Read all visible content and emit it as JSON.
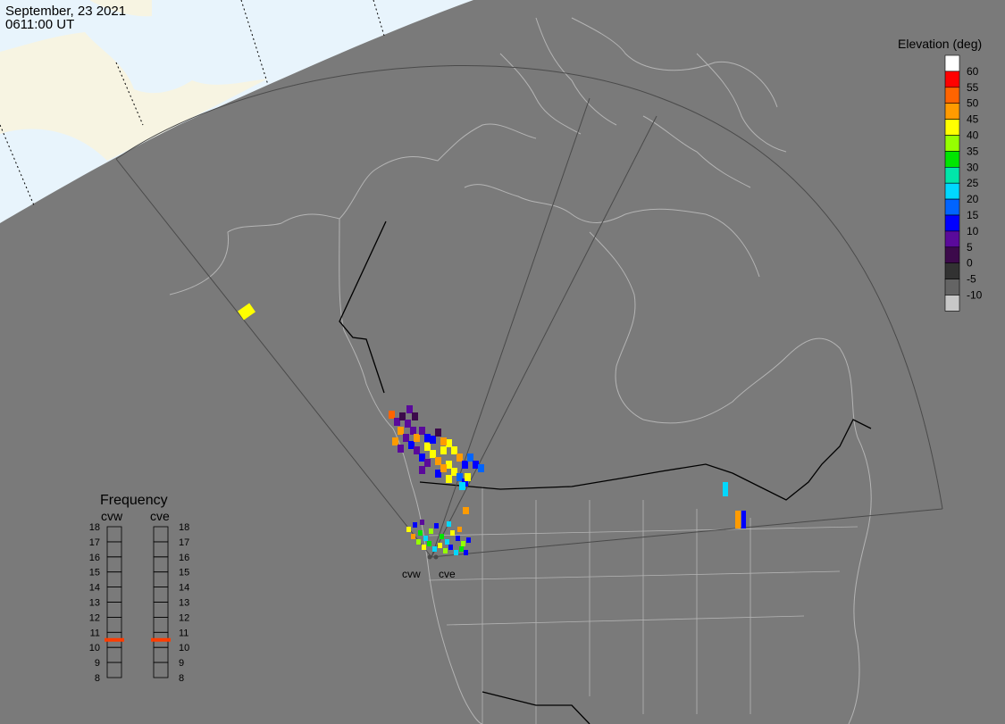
{
  "header": {
    "date": "September, 23 2021",
    "time": "0611:00 UT"
  },
  "colors": {
    "background": "#7a7a7a",
    "daylight_ocean": "#e8f4fc",
    "daylight_land": "#f7f4e2",
    "coastline": "#b4b4b4",
    "borders": "#000000",
    "fov": "#4a4a4a"
  },
  "elevation_scale": {
    "title": "Elevation (deg)",
    "levels": [
      {
        "label": "60",
        "color": "#ffffff"
      },
      {
        "label": "55",
        "color": "#ff0000"
      },
      {
        "label": "50",
        "color": "#ff6400"
      },
      {
        "label": "45",
        "color": "#ff9b00"
      },
      {
        "label": "40",
        "color": "#ffff00"
      },
      {
        "label": "35",
        "color": "#96ff00"
      },
      {
        "label": "30",
        "color": "#00e600"
      },
      {
        "label": "25",
        "color": "#00e6aa"
      },
      {
        "label": "20",
        "color": "#00d8ff"
      },
      {
        "label": "15",
        "color": "#0064ff"
      },
      {
        "label": "10",
        "color": "#0000ff"
      },
      {
        "label": "5",
        "color": "#5a0a9b"
      },
      {
        "label": "0",
        "color": "#3c0a4b"
      },
      {
        "label": "-5",
        "color": "#323232"
      },
      {
        "label": "-10",
        "color": "#646464"
      },
      {
        "label": "",
        "color": "#c8c8c8"
      }
    ]
  },
  "radars": [
    {
      "id": "cvw",
      "label": "cvw"
    },
    {
      "id": "cve",
      "label": "cve"
    }
  ],
  "frequency_panel": {
    "title": "Frequency",
    "range_min": 8,
    "range_max": 18,
    "tick_labels": [
      "18",
      "17",
      "16",
      "15",
      "14",
      "13",
      "12",
      "11",
      "10",
      "9",
      "8"
    ],
    "columns": [
      {
        "label": "cvw",
        "value_mhz": 10.5
      },
      {
        "label": "cve",
        "value_mhz": 10.5
      }
    ],
    "marker_color": "#ff3c00"
  }
}
